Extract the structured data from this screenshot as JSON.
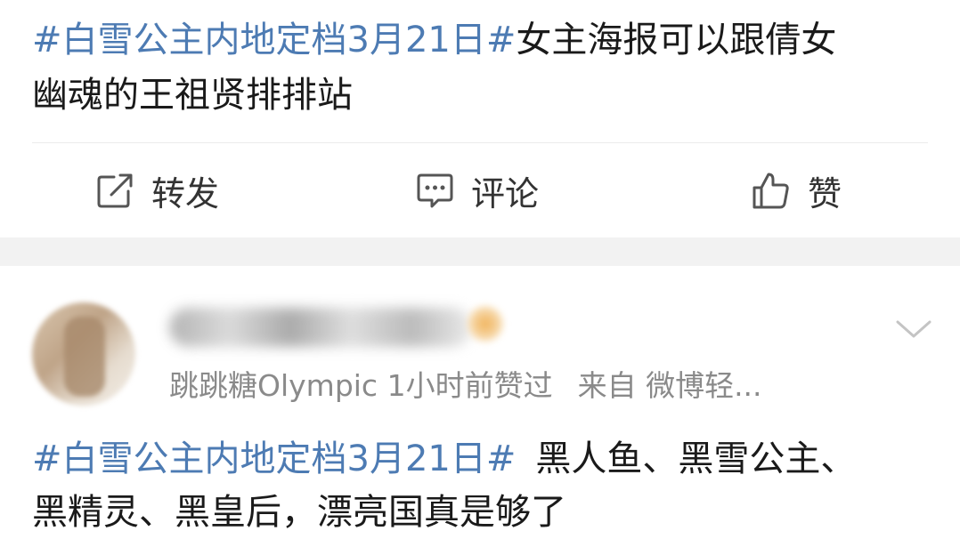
{
  "post1": {
    "hashtag": "#白雪公主内地定档3月21日#",
    "text_line1": "女主海报可以跟倩女",
    "text_line2": "幽魂的王祖贤排排站"
  },
  "actions": {
    "repost_label": "转发",
    "comment_label": "评论",
    "like_label": "赞"
  },
  "comment": {
    "meta_prefix": "跳跳糖Olympic 1小时前赞过",
    "source": "来自 微博轻...",
    "hashtag": "#白雪公主内地定档3月21日#",
    "text": "黑人鱼、黑雪公主、",
    "text_line2": "黑精灵、黑皇后，漂亮国真是够了"
  },
  "colors": {
    "hashtag": "#4d7bb3",
    "text": "#1a1a1a",
    "meta": "#8a8a8a",
    "divider": "#ececec",
    "section_gap": "#f2f2f2"
  },
  "icons": [
    "repost-icon",
    "comment-icon",
    "like-icon",
    "chevron-down-icon"
  ]
}
